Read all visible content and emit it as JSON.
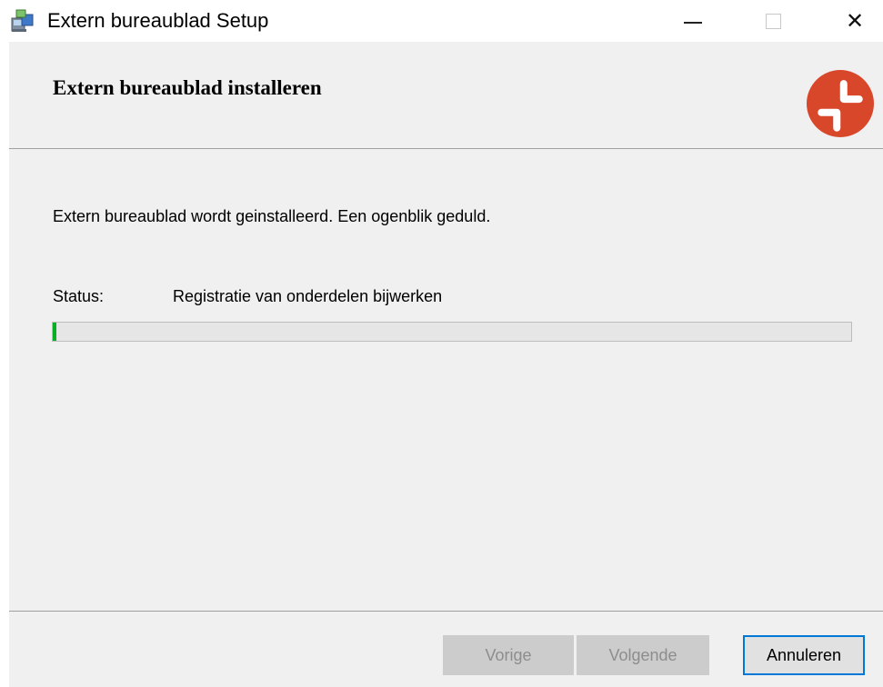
{
  "window": {
    "title": "Extern bureaublad Setup",
    "icons": {
      "app": "installer-package-icon",
      "minimize": "minimize-icon",
      "maximize": "maximize-icon",
      "close": "close-icon",
      "close_glyph": "✕"
    }
  },
  "banner": {
    "title": "Extern bureaublad installeren",
    "logo": "remote-desktop-logo-icon",
    "logo_color": "#d9472b"
  },
  "body": {
    "description": "Extern bureaublad wordt geinstalleerd. Een ogenblik geduld.",
    "status_label": "Status:",
    "status_value": "Registratie van onderdelen bijwerken",
    "progress_percent": 0.5,
    "progress_color": "#06b025"
  },
  "footer": {
    "back_label": "Vorige",
    "next_label": "Volgende",
    "cancel_label": "Annuleren",
    "accent_color": "#0078d7"
  }
}
